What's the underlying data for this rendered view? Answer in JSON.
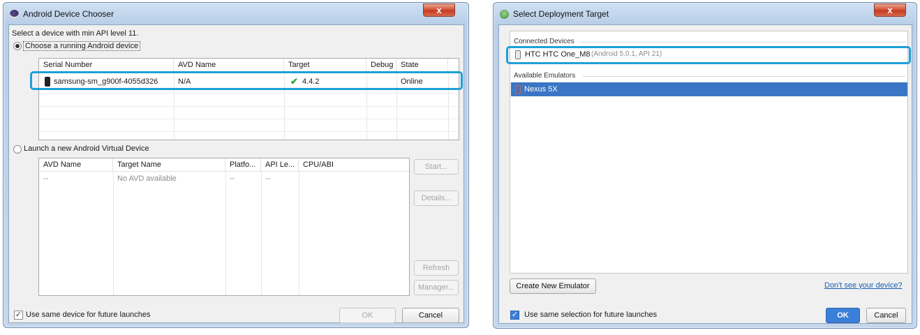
{
  "colors": {
    "highlight": "#1ea0d8",
    "selection": "#3b76c6",
    "ok_blue": "#3c7fd9",
    "check_green": "#2ea043"
  },
  "left_dialog": {
    "title": "Android Device Chooser",
    "title_icon": "eclipse-icon",
    "close_glyph": "x",
    "prompt": "Select a device with min API level 11.",
    "running_option": {
      "label": "Choose a running Android device",
      "selected": true
    },
    "device_table": {
      "columns": [
        "Serial Number",
        "AVD Name",
        "Target",
        "Debug",
        "State"
      ],
      "rows": [
        {
          "icon": "phone-icon",
          "serial": "samsung-sm_g900f-4055d326",
          "avd": "N/A",
          "target_icon": "checkmark-icon",
          "target": "4.4.2",
          "debug": "",
          "state": "Online"
        }
      ]
    },
    "launch_option": {
      "label": "Launch a new Android Virtual Device",
      "selected": false
    },
    "avd_table": {
      "columns": [
        "AVD Name",
        "Target Name",
        "Platfo...",
        "API Le...",
        "CPU/ABI"
      ],
      "rows": [
        {
          "avd": "--",
          "target": "No AVD available",
          "platform": "--",
          "api": "--",
          "cpu": ""
        }
      ]
    },
    "side_buttons": {
      "start": "Start...",
      "details": "Details...",
      "refresh": "Refresh",
      "manager": "Manager..."
    },
    "footer": {
      "checkbox_label": "Use same device for future launches",
      "checked": true,
      "ok": "OK",
      "cancel": "Cancel"
    }
  },
  "right_dialog": {
    "title": "Select Deployment Target",
    "title_icon": "android-icon",
    "close_glyph": "x",
    "connected": {
      "header": "Connected Devices",
      "device_name": "HTC HTC One_M8",
      "device_detail": "(Android 5.0.1, API 21)"
    },
    "emulators": {
      "header": "Available Emulators",
      "items": [
        {
          "name": "Nexus 5X",
          "selected": true
        }
      ]
    },
    "create_button": "Create New Emulator",
    "help_link": "Don't see your device?",
    "footer": {
      "checkbox_label": "Use same selection for future launches",
      "checked": true,
      "ok": "OK",
      "cancel": "Cancel"
    }
  }
}
